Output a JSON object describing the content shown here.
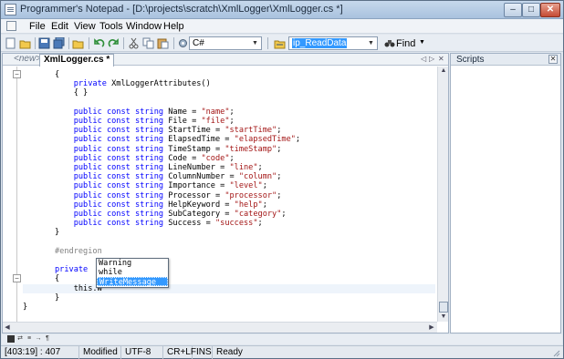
{
  "window": {
    "title": "Programmer's Notepad - [D:\\projects\\scratch\\XmlLogger\\XmlLogger.cs *]",
    "minimize_glyph": "–",
    "maximize_glyph": "□",
    "close_glyph": "✕"
  },
  "menu": {
    "items": [
      "File",
      "Edit",
      "View",
      "Tools",
      "Window",
      "Help"
    ]
  },
  "toolbar": {
    "scheme_value": "C#",
    "search_value": "ip_ReadData",
    "find_label": "Find",
    "dropdown_glyph": "▼"
  },
  "tabs": {
    "new_label": "<new>",
    "active_label": "XmlLogger.cs *",
    "prev_glyph": "◁",
    "next_glyph": "▷",
    "close_glyph": "✕"
  },
  "code": {
    "lines": [
      "{",
      "    private XmlLoggerAttributes()",
      "    { }",
      "",
      "    public const string Name = \"name\";",
      "    public const string File = \"file\";",
      "    public const string StartTime = \"startTime\";",
      "    public const string ElapsedTime = \"elapsedTime\";",
      "    public const string TimeStamp = \"timeStamp\";",
      "    public const string Code = \"code\";",
      "    public const string LineNumber = \"line\";",
      "    public const string ColumnNumber = \"column\";",
      "    public const string Importance = \"level\";",
      "    public const string Processor = \"processor\";",
      "    public const string HelpKeyword = \"help\";",
      "    public const string SubCategory = \"category\";",
      "    public const string Success = \"success\";",
      "}",
      "",
      "#endregion",
      "",
      "private",
      "{",
      "    this.W",
      "}",
      "}"
    ]
  },
  "autocomplete": {
    "items": [
      "Warning",
      "while",
      "WriteMessage"
    ],
    "selected_index": 2
  },
  "scripts": {
    "title": "Scripts",
    "close_glyph": "✕"
  },
  "status": {
    "position": "[403:19] : 407",
    "modified": "Modified",
    "encoding": "UTF-8",
    "line_endings": "CR+LF",
    "insert_mode": "INS",
    "state": "Ready"
  },
  "colors": {
    "keyword": "#0000ff",
    "string": "#a31515",
    "preprocessor": "#808080",
    "selection": "#3399ff"
  }
}
